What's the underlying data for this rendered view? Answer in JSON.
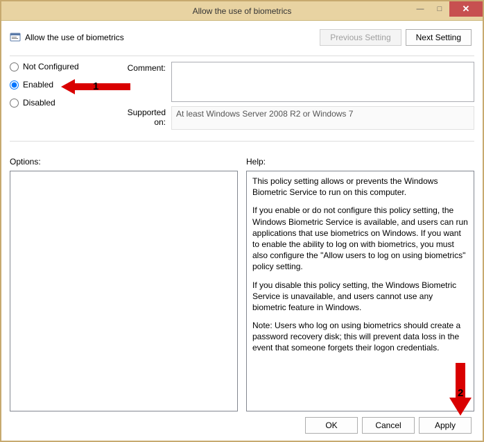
{
  "window": {
    "title": "Allow the use of biometrics"
  },
  "header": {
    "policy_title": "Allow the use of biometrics",
    "previous_setting": "Previous Setting",
    "next_setting": "Next Setting"
  },
  "radios": {
    "not_configured": "Not Configured",
    "enabled": "Enabled",
    "disabled": "Disabled",
    "selected": "enabled"
  },
  "fields": {
    "comment_label": "Comment:",
    "comment_value": "",
    "supported_label": "Supported on:",
    "supported_value": "At least Windows Server 2008 R2 or Windows 7"
  },
  "lower": {
    "options_label": "Options:",
    "help_label": "Help:",
    "options_text": "",
    "help_p1": "This policy setting allows or prevents the Windows Biometric Service to run on this computer.",
    "help_p2": "If you enable or do not configure this policy setting, the Windows Biometric Service is available, and users can run applications that use biometrics on Windows. If you want to enable the ability to log on with biometrics, you must also configure the \"Allow users to log on using biometrics\" policy setting.",
    "help_p3": "If you disable this policy setting, the Windows Biometric Service is unavailable, and users cannot use any biometric feature in Windows.",
    "help_p4": "Note: Users who log on using biometrics should create a password recovery disk; this will prevent data loss in the event that someone forgets their logon credentials."
  },
  "footer": {
    "ok": "OK",
    "cancel": "Cancel",
    "apply": "Apply"
  },
  "annotations": {
    "one": "1",
    "two": "2"
  }
}
